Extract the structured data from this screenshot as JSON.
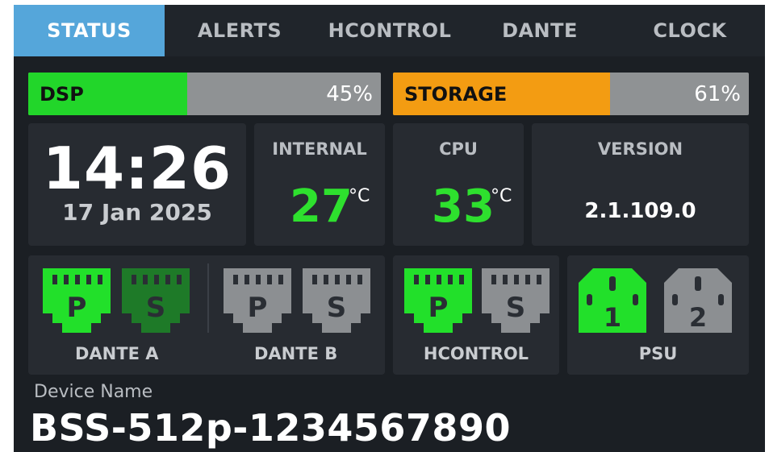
{
  "tabs": [
    {
      "label": "STATUS",
      "active": true
    },
    {
      "label": "ALERTS",
      "active": false
    },
    {
      "label": "HCONTROL",
      "active": false
    },
    {
      "label": "DANTE",
      "active": false
    },
    {
      "label": "CLOCK",
      "active": false
    }
  ],
  "meters": {
    "dsp": {
      "label": "DSP",
      "value_text": "45%",
      "level": 0.45,
      "color": "#22d62a"
    },
    "storage": {
      "label": "STORAGE",
      "value_text": "61%",
      "level": 0.61,
      "color": "#f39c12"
    }
  },
  "clock": {
    "time": "14:26",
    "date": "17 Jan 2025"
  },
  "internal": {
    "title": "INTERNAL",
    "value": "27",
    "unit": "°C"
  },
  "cpu": {
    "title": "CPU",
    "value": "33",
    "unit": "°C"
  },
  "version": {
    "title": "VERSION",
    "value": "2.1.109.0"
  },
  "ports": {
    "dante": {
      "a_label": "DANTE A",
      "b_label": "DANTE B",
      "a_primary": {
        "letter": "P",
        "state": "active-bright"
      },
      "a_secondary": {
        "letter": "S",
        "state": "active-dim"
      },
      "b_primary": {
        "letter": "P",
        "state": "inactive"
      },
      "b_secondary": {
        "letter": "S",
        "state": "inactive"
      }
    },
    "hcontrol": {
      "label": "HCONTROL",
      "primary": {
        "letter": "P",
        "state": "active-bright"
      },
      "secondary": {
        "letter": "S",
        "state": "inactive"
      }
    },
    "psu": {
      "label": "PSU",
      "unit1": {
        "number": "1",
        "state": "active-bright"
      },
      "unit2": {
        "number": "2",
        "state": "inactive"
      }
    }
  },
  "colors": {
    "bright_green": "#22e02a",
    "dim_green": "#1e7a28",
    "inactive_gray": "#8c8f92",
    "accent_blue": "#55a6da"
  },
  "device": {
    "label": "Device Name",
    "name": "BSS-512p-1234567890"
  }
}
